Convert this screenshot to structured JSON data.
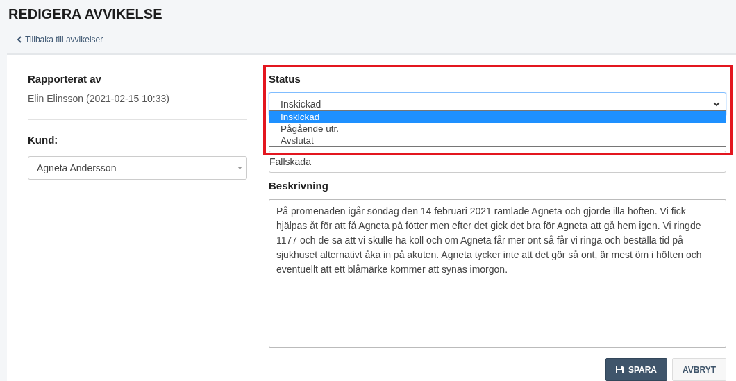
{
  "page": {
    "title": "REDIGERA AVVIKELSE",
    "back_link": "Tillbaka till avvikelser"
  },
  "reported_by": {
    "label": "Rapporterat av",
    "value": "Elin Elinsson (2021-02-15 10:33)"
  },
  "customer": {
    "label": "Kund:",
    "value": "Agneta Andersson"
  },
  "status": {
    "label": "Status",
    "value": "Inskickad",
    "expanded": true,
    "options": [
      {
        "label": "Inskickad",
        "selected": true
      },
      {
        "label": "Pågående utr.",
        "selected": false
      },
      {
        "label": "Avslutat",
        "selected": false
      }
    ]
  },
  "category_field": {
    "value": "Fallskada"
  },
  "description": {
    "label": "Beskrivning",
    "value": "På promenaden igår söndag den 14 februari 2021 ramlade Agneta och gjorde illa höften. Vi fick hjälpas åt för att få Agneta på fötter men efter det gick det bra för Agneta att gå hem igen. Vi ringde 1177 och de sa att vi skulle ha koll och om Agneta får mer ont så får vi ringa och beställa tid på sjukhuset alternativt åka in på akuten. Agneta tycker inte att det gör så ont, är mest öm i höften och eventuellt att ett blåmärke kommer att synas imorgon."
  },
  "buttons": [
    {
      "kind": "save",
      "label": "SPARA"
    },
    {
      "kind": "cancel",
      "label": "AVBRYT"
    }
  ],
  "highlight": {
    "on": true
  }
}
